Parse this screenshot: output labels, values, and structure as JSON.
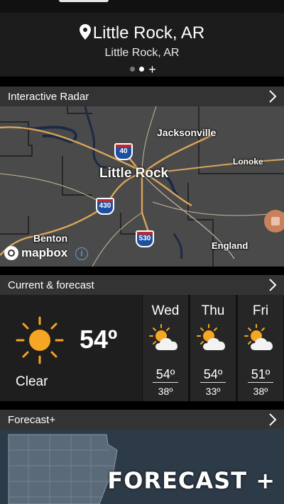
{
  "location": {
    "title": "Little Rock, AR",
    "subtitle": "Little Rock, AR",
    "page_count": 2,
    "active_page": 2
  },
  "radar": {
    "header": "Interactive Radar",
    "labels": {
      "jacksonville": "Jacksonville",
      "lonoke": "Lonoke",
      "little_rock": "Little Rock",
      "benton": "Benton",
      "england": "England"
    },
    "highways": [
      "40",
      "430",
      "530"
    ],
    "attribution": "mapbox"
  },
  "current": {
    "header": "Current & forecast",
    "temperature": "54º",
    "condition": "Clear",
    "icon": "sun-icon"
  },
  "forecast": [
    {
      "day": "Wed",
      "high": "54º",
      "low": "38º",
      "icon": "partly-sunny-icon"
    },
    {
      "day": "Thu",
      "high": "54º",
      "low": "33º",
      "icon": "partly-sunny-icon"
    },
    {
      "day": "Fri",
      "high": "51º",
      "low": "38º",
      "icon": "partly-sunny-icon"
    }
  ],
  "forecast_plus": {
    "header": "Forecast+",
    "banner_text": "FORECAST +"
  },
  "colors": {
    "accent_sun": "#f5a623",
    "section_header": "#333333",
    "highway_shield": "#1f4fa0"
  }
}
